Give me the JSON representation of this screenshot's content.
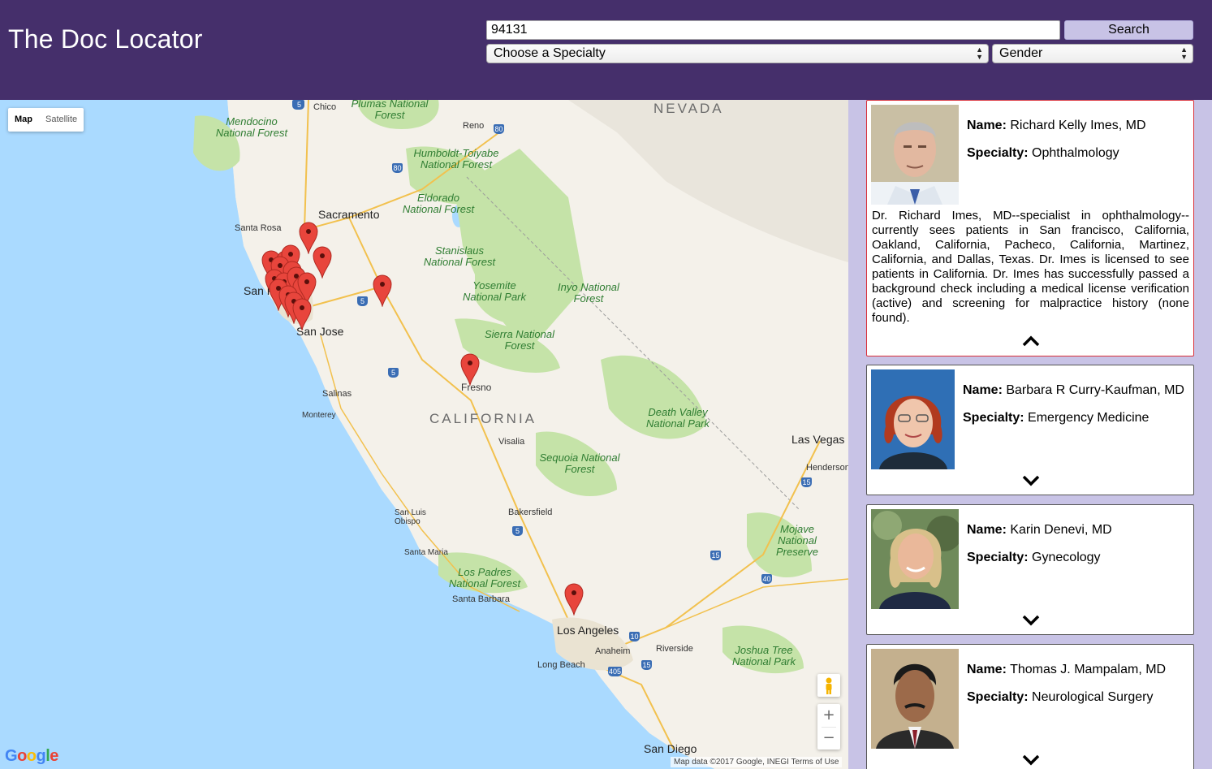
{
  "header": {
    "title": "The Doc Locator",
    "search_value": "94131",
    "search_button": "Search",
    "specialty_select": "Choose a Specialty",
    "gender_select": "Gender"
  },
  "map": {
    "map_type_options": [
      "Map",
      "Satellite"
    ],
    "active_map_type": "Map",
    "zoom_in": "+",
    "zoom_out": "−",
    "logo": "Google",
    "attribution": "Map data ©2017 Google, INEGI   Terms of Use",
    "state_labels": [
      "NEVADA",
      "CALIFORNIA"
    ],
    "park_labels": [
      "Mendocino National Forest",
      "Plumas National Forest",
      "Humboldt-Toiyabe National Forest",
      "Eldorado National Forest",
      "Stanislaus National Forest",
      "Yosemite National Park",
      "Inyo National Forest",
      "Sierra National Forest",
      "Death Valley National Park",
      "Sequoia National Forest",
      "Mojave National Preserve",
      "Los Padres National Forest",
      "Joshua Tree National Park"
    ],
    "city_labels": [
      "Sacramento",
      "San Jose",
      "Fresno",
      "Las Vegas",
      "Los Angeles",
      "San Diego",
      "Bakersfield",
      "Reno",
      "Chico",
      "Santa Rosa",
      "San Fr",
      "Salinas",
      "Monterey",
      "Visalia",
      "Henderson",
      "San Luis Obispo",
      "Santa Maria",
      "Santa Barbara",
      "Anaheim",
      "Riverside",
      "Long Beach"
    ],
    "highway_shields": [
      "5",
      "80",
      "80",
      "5",
      "5",
      "5",
      "15",
      "15",
      "40",
      "10",
      "405",
      "15",
      "5"
    ],
    "marker_color": "#e8453c",
    "water_color": "#aadaff",
    "land_color": "#f4f1ea",
    "park_color": "#c5e3a8"
  },
  "doctors": [
    {
      "name_label": "Name:",
      "name": "Richard Kelly Imes, MD",
      "specialty_label": "Specialty:",
      "specialty": "Ophthalmology",
      "bio": "Dr. Richard Imes, MD--specialist in ophthalmology--currently sees patients in San francisco, California, Oakland, California, Pacheco, California, Martinez, California, and Dallas, Texas. Dr. Imes is licensed to see patients in California. Dr. Imes has successfully passed a background check including a medical license verification (active) and screening for malpractice history (none found).",
      "expanded": true,
      "toggle_icon": "chevron-up-icon"
    },
    {
      "name_label": "Name:",
      "name": "Barbara R Curry-Kaufman, MD",
      "specialty_label": "Specialty:",
      "specialty": "Emergency Medicine",
      "expanded": false,
      "toggle_icon": "chevron-down-icon"
    },
    {
      "name_label": "Name:",
      "name": "Karin Denevi, MD",
      "specialty_label": "Specialty:",
      "specialty": "Gynecology",
      "expanded": false,
      "toggle_icon": "chevron-down-icon"
    },
    {
      "name_label": "Name:",
      "name": "Thomas J. Mampalam, MD",
      "specialty_label": "Specialty:",
      "specialty": "Neurological Surgery",
      "expanded": false,
      "toggle_icon": "chevron-down-icon"
    }
  ],
  "colors": {
    "header_bg": "#452f6b",
    "panel_bg": "#c8c3e6",
    "selected_border": "#d9303a"
  }
}
